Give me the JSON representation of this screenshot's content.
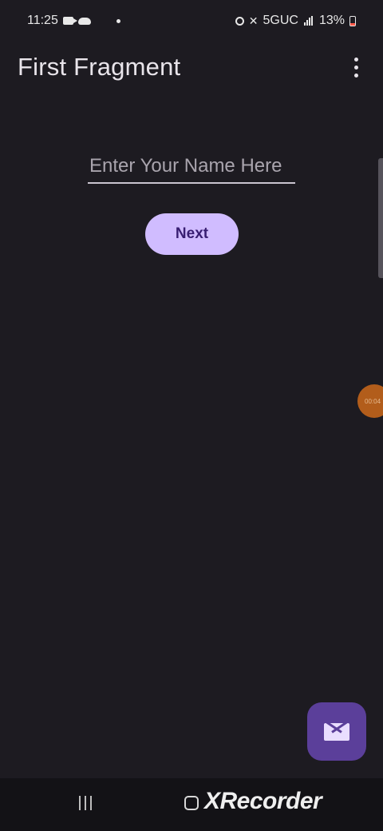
{
  "status_bar": {
    "time": "11:25",
    "network": "5GUC",
    "battery": "13%"
  },
  "toolbar": {
    "title": "First Fragment",
    "overflow_icon": "more-vert-icon"
  },
  "form": {
    "name_placeholder": "Enter Your Name Here",
    "name_value": "",
    "next_label": "Next"
  },
  "recorder_bubble": {
    "text": "00:04"
  },
  "fab": {
    "icon": "mail-icon",
    "color": "#5b3f9a"
  },
  "nav_bar": {
    "watermark": "XRecorder"
  },
  "colors": {
    "background": "#1d1b21",
    "primary": "#d0bcff",
    "on_primary": "#381e72"
  }
}
